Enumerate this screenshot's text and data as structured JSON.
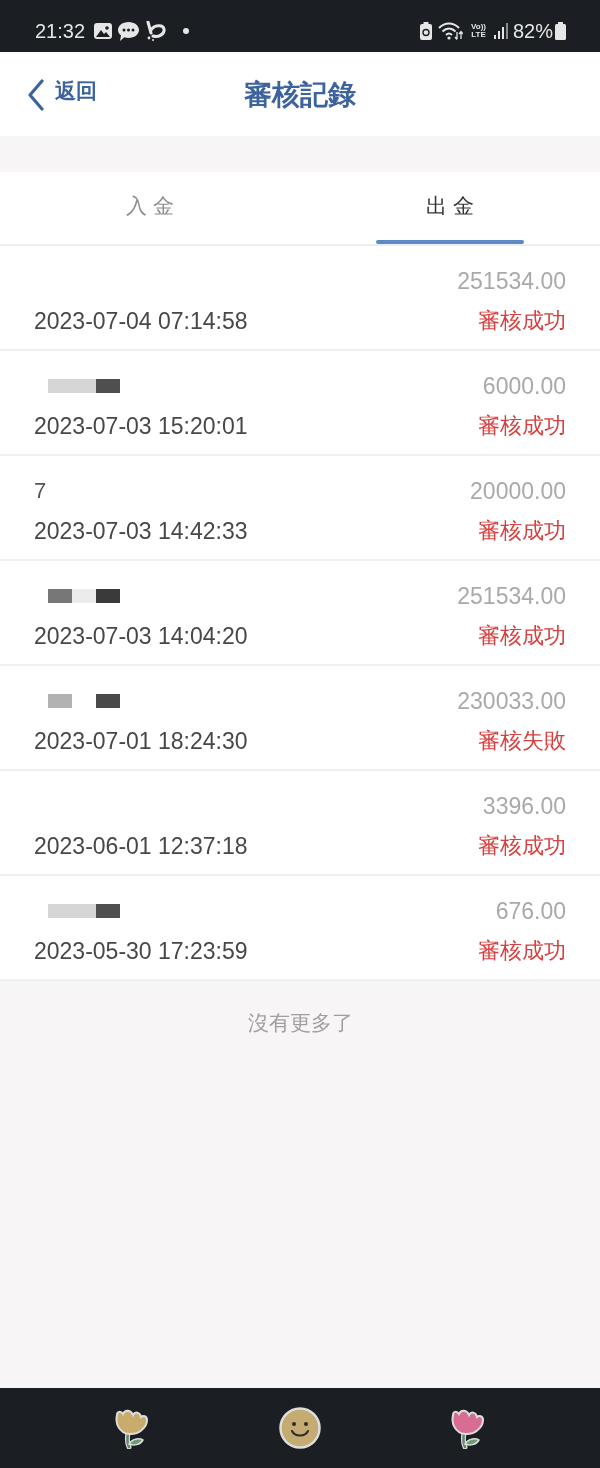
{
  "status_bar": {
    "time": "21:32",
    "volte": [
      "Vo))",
      "LTE"
    ],
    "battery": "82%"
  },
  "header": {
    "back": "返回",
    "title": "審核記錄"
  },
  "tabs": [
    {
      "label": "入 金",
      "selected": false
    },
    {
      "label": "出 金",
      "selected": true
    }
  ],
  "records": [
    {
      "redacted": false,
      "amount": "251534.00",
      "time": "2023-07-04 07:14:58",
      "status": "審核成功"
    },
    {
      "redacted": true,
      "amount": "6000.00",
      "time": "2023-07-03 15:20:01",
      "status": "審核成功"
    },
    {
      "redacted": false,
      "account": "7",
      "amount": "20000.00",
      "time": "2023-07-03 14:42:33",
      "status": "審核成功"
    },
    {
      "redacted": true,
      "amount": "251534.00",
      "time": "2023-07-03 14:04:20",
      "status": "審核成功"
    },
    {
      "redacted": true,
      "amount": "230033.00",
      "time": "2023-07-01 18:24:30",
      "status": "審核失敗"
    },
    {
      "redacted": false,
      "amount": "3396.00",
      "time": "2023-06-01 12:37:18",
      "status": "審核成功"
    },
    {
      "redacted": true,
      "amount": "676.00",
      "time": "2023-05-30 17:23:59",
      "status": "審核成功"
    }
  ],
  "footer": "沒有更多了"
}
